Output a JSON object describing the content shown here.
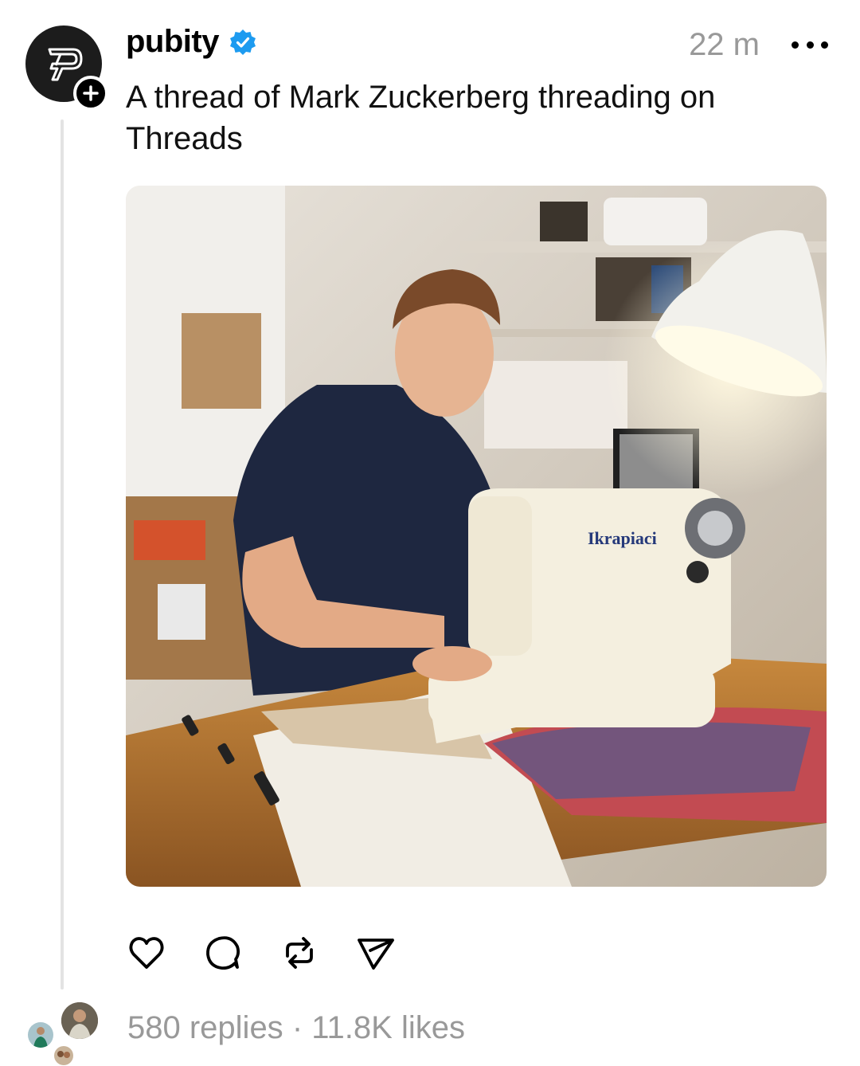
{
  "post": {
    "username": "pubity",
    "verified": true,
    "timestamp": "22 m",
    "caption": "A thread of Mark Zuckerberg threading on Threads",
    "image_alt": "Mark Zuckerberg sitting at a sewing machine in a cluttered workshop",
    "sewing_machine_brand": "Ikrapiaci",
    "stats": {
      "replies": "580 replies",
      "separator": "·",
      "likes": "11.8K likes"
    }
  },
  "actions": [
    {
      "name": "like",
      "icon": "heart-icon"
    },
    {
      "name": "reply",
      "icon": "comment-icon"
    },
    {
      "name": "repost",
      "icon": "repost-icon"
    },
    {
      "name": "share",
      "icon": "send-icon"
    }
  ],
  "colors": {
    "verified_blue": "#1D9BF0",
    "muted_text": "#999999",
    "thread_line": "#E3E3E3"
  }
}
